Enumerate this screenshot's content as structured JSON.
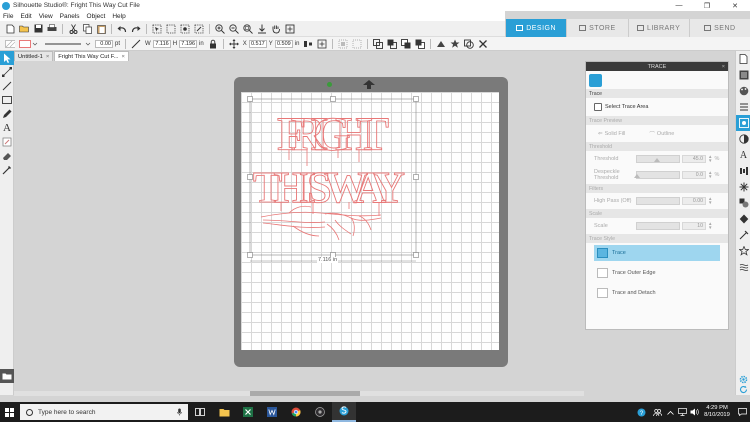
{
  "window": {
    "title": "Silhouette Studio®: Fright This Way Cut File",
    "minimize": "—",
    "maximize": "❐",
    "close": "✕"
  },
  "menu": [
    "File",
    "Edit",
    "View",
    "Panels",
    "Object",
    "Help"
  ],
  "top_tabs": [
    {
      "label": "DESIGN",
      "active": true
    },
    {
      "label": "STORE",
      "active": false
    },
    {
      "label": "LIBRARY",
      "active": false
    },
    {
      "label": "SEND",
      "active": false
    }
  ],
  "toolbar2": {
    "line_width": "0.00",
    "line_unit": "pt",
    "w_label": "W",
    "w_value": "7.116",
    "h_label": "H",
    "h_value": "7.196",
    "wh_unit": "in",
    "x_label": "X",
    "x_value": "0.517",
    "y_label": "Y",
    "y_value": "0.509",
    "xy_unit": "in"
  },
  "doc_tabs": [
    {
      "label": "Untitled-1",
      "close": "×",
      "active": false
    },
    {
      "label": "Fright This Way Cut F...",
      "close": "×",
      "active": true
    }
  ],
  "canvas": {
    "design_line1": "FRIGHT",
    "design_line2": "THIS WAY",
    "selection_width_label": "7.116 in",
    "accent_color": "#e87878"
  },
  "trace_panel": {
    "title": "TRACE",
    "close": "×",
    "sections": {
      "trace": "Trace",
      "trace_preview": "Trace Preview",
      "threshold": "Threshold",
      "filters": "Filters",
      "scale": "Scale",
      "trace_style": "Trace Style"
    },
    "select_trace_area": "Select Trace Area",
    "solid_fill": "Solid Fill",
    "outline": "Outline",
    "threshold_label": "Threshold",
    "threshold_value": "45.0",
    "threshold_unit": "%",
    "threshold_level": 0.45,
    "despeckle_label": "Despeckle Threshold",
    "despeckle_value": "0.0",
    "despeckle_unit": "%",
    "highpass_label": "High Pass (Off)",
    "highpass_value": "0.00",
    "scale_label": "Scale",
    "scale_value": "10",
    "styles": [
      {
        "label": "Trace",
        "active": true
      },
      {
        "label": "Trace Outer Edge",
        "active": false
      },
      {
        "label": "Trace and Detach",
        "active": false
      }
    ]
  },
  "taskbar": {
    "search_placeholder": "Type here to search",
    "time": "4:29 PM",
    "date": "8/10/2019"
  },
  "colors": {
    "accent": "#2a9fd6",
    "design_stroke": "#e87878"
  }
}
